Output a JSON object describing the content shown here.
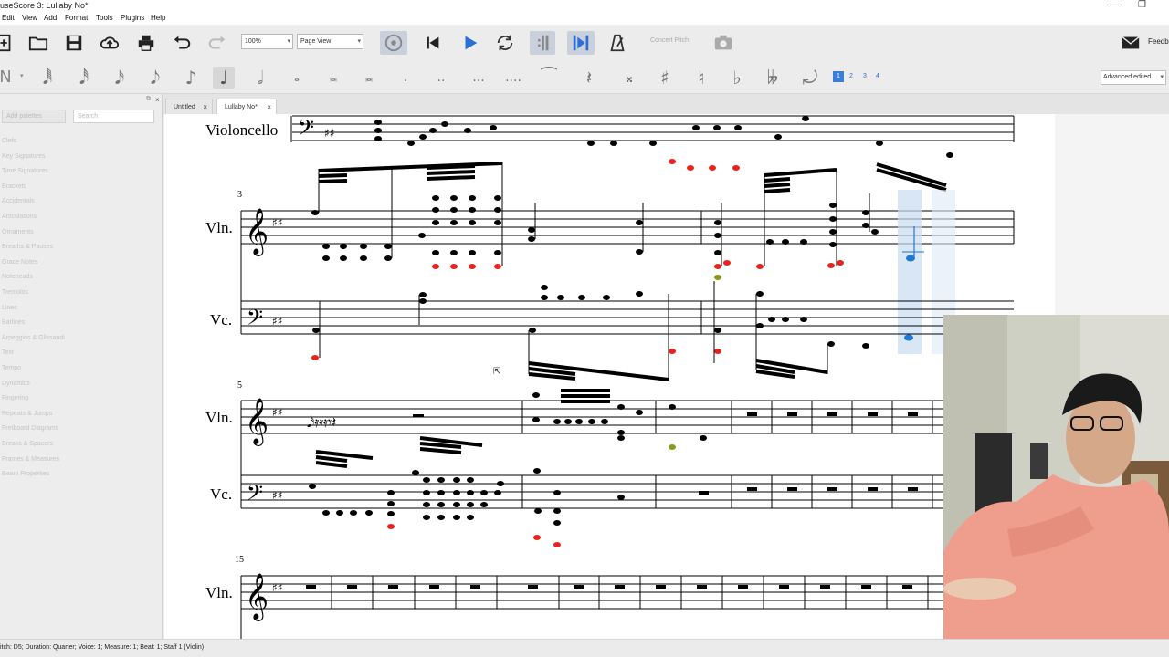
{
  "window": {
    "title": "useScore 3: Lullaby No*"
  },
  "menu": [
    "Edit",
    "View",
    "Add",
    "Format",
    "Tools",
    "Plugins",
    "Help"
  ],
  "toolbar": {
    "zoom_value": "100%",
    "view_mode": "Page View",
    "concert_pitch_label": "Concert Pitch",
    "feedback_label": "Feedb"
  },
  "note_input": {
    "mode_label": "N",
    "voices": [
      "1",
      "2",
      "3",
      "4"
    ],
    "workspace": "Advanced edited"
  },
  "palette": {
    "add_palettes_label": "Add palettes",
    "search_placeholder": "Search",
    "items": [
      "Clefs",
      "Key Signatures",
      "Time Signatures",
      "Brackets",
      "Accidentals",
      "Articulations",
      "Ornaments",
      "Breaths & Pauses",
      "Grace Notes",
      "Noteheads",
      "Tremolos",
      "Lines",
      "Barlines",
      "Arpeggios & Glissandi",
      "Text",
      "Tempo",
      "Dynamics",
      "Fingering",
      "Repeats & Jumps",
      "Fretboard Diagrams",
      "Breaks & Spacers",
      "Frames & Measures",
      "Beam Properties"
    ]
  },
  "tabs": [
    {
      "label": "Untitled",
      "active": false
    },
    {
      "label": "Lullaby No*",
      "active": true
    }
  ],
  "score": {
    "instrument_full_vc": "Violoncello",
    "short_vln": "Vln.",
    "short_vc": "Vc.",
    "measure_numbers": [
      "3",
      "5",
      "15"
    ]
  },
  "statusbar": {
    "text": "itch: D5; Duration: Quarter; Voice: 1;  Measure: 1; Beat: 1; Staff 1 (Violin)"
  },
  "colors": {
    "selection_blue": "#1f78d1",
    "out_of_range_red": "#e8231e",
    "olive": "#8a9a1a"
  }
}
